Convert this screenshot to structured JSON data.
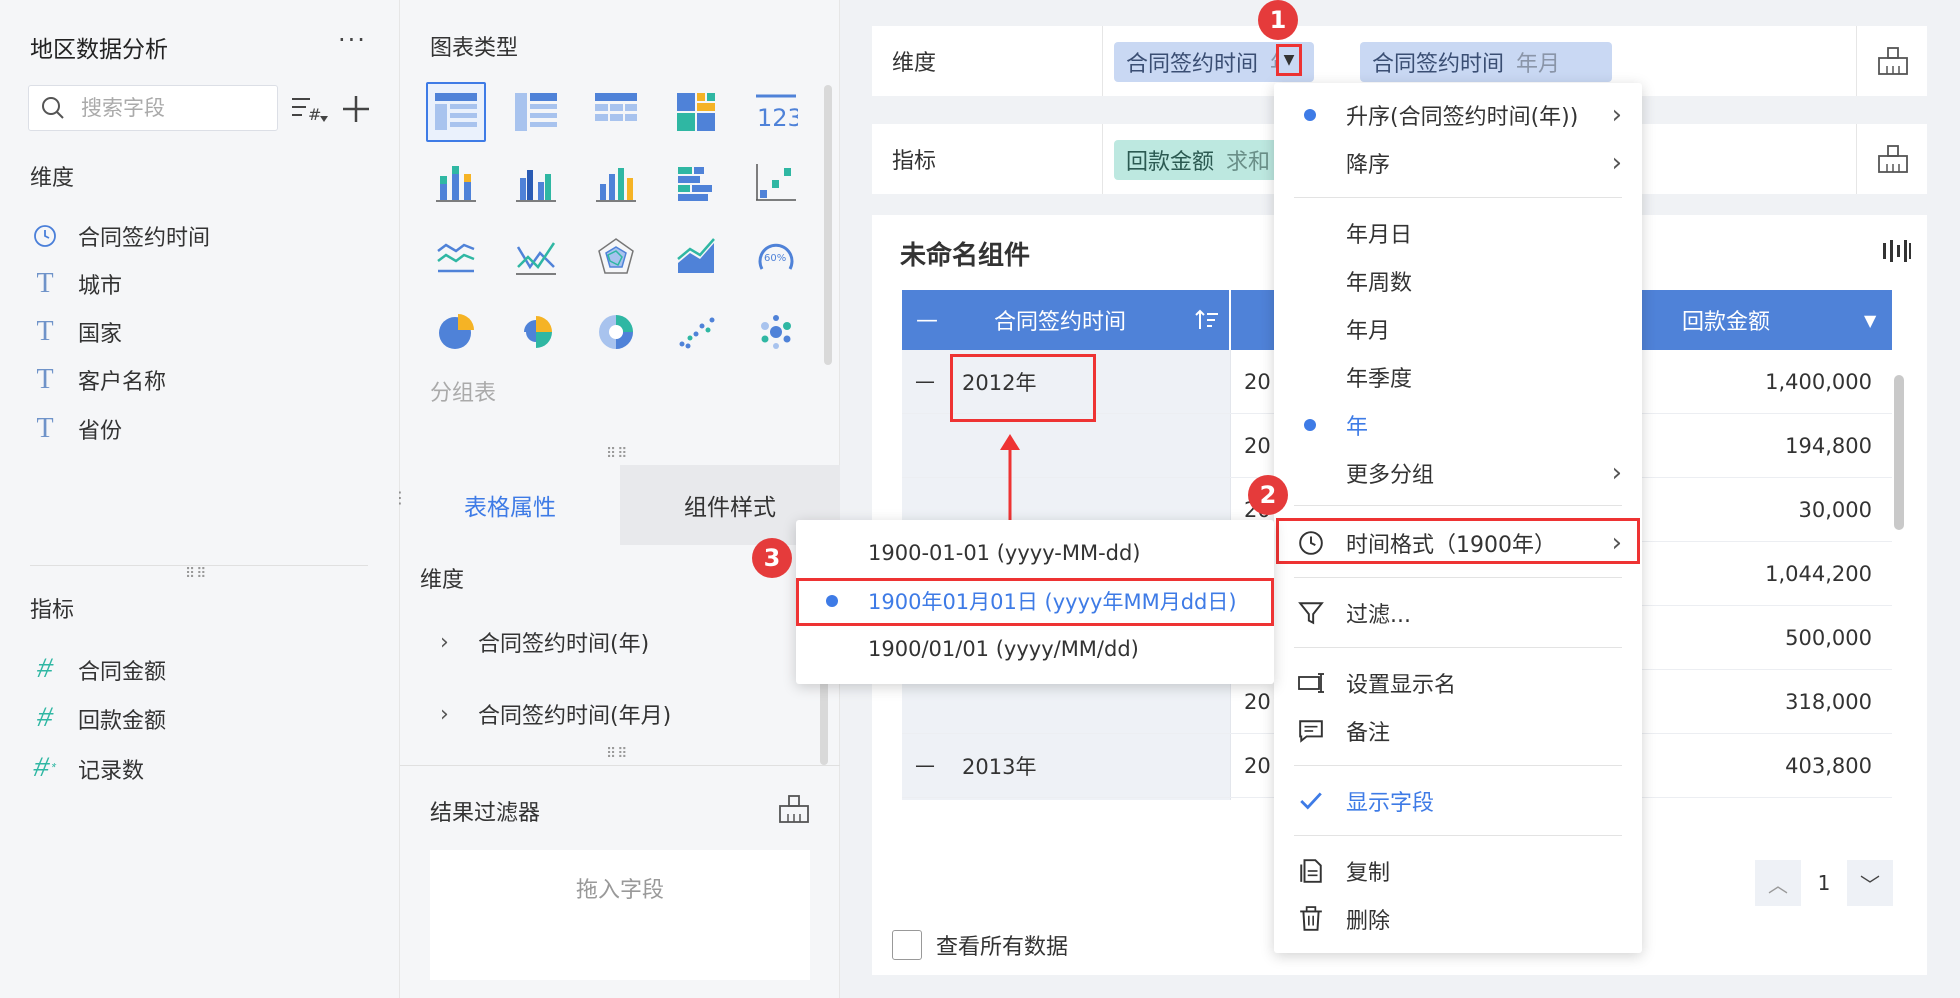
{
  "left": {
    "title": "地区数据分析",
    "more": "···",
    "search_placeholder": "搜索字段",
    "dim_label": "维度",
    "dimensions": [
      {
        "icon": "clock-icon",
        "label": "合同签约时间"
      },
      {
        "icon": "text-type-icon",
        "label": "城市"
      },
      {
        "icon": "text-type-icon",
        "label": "国家"
      },
      {
        "icon": "text-type-icon",
        "label": "客户名称"
      },
      {
        "icon": "text-type-icon",
        "label": "省份"
      }
    ],
    "metric_label": "指标",
    "metrics": [
      {
        "icon": "number-type-icon",
        "label": "合同金额"
      },
      {
        "icon": "number-type-icon",
        "label": "回款金额"
      },
      {
        "icon": "record-count-icon",
        "label": "记录数"
      }
    ]
  },
  "mid": {
    "title": "图表类型",
    "caption": "分组表",
    "tabs": [
      "表格属性",
      "组件样式"
    ],
    "dim_label": "维度",
    "dim_items": [
      "合同签约时间(年)",
      "合同签约时间(年月)"
    ],
    "filter_title": "结果过滤器",
    "drop_text": "拖入字段"
  },
  "right": {
    "dim_row_label": "维度",
    "dim_pills": [
      {
        "name": "合同签约时间",
        "sub": "年"
      },
      {
        "name": "合同签约时间",
        "sub": "年月"
      }
    ],
    "metric_row_label": "指标",
    "metric_pill": {
      "name": "回款金额",
      "sub": "求和"
    },
    "widget_title": "未命名组件",
    "header": {
      "col1": "合同签约时间",
      "col3": "回款金额"
    },
    "rows": [
      {
        "group": "2012年",
        "sub": "20",
        "value": "1,400,000"
      },
      {
        "group": "",
        "sub": "20",
        "value": "194,800"
      },
      {
        "group": "",
        "sub": "20",
        "value": "30,000"
      },
      {
        "group": "",
        "sub": "",
        "value": "1,044,200"
      },
      {
        "group": "",
        "sub": "",
        "value": "500,000"
      },
      {
        "group": "",
        "sub": "20",
        "value": "318,000"
      },
      {
        "group": "2013年",
        "sub": "20",
        "value": "403,800"
      }
    ],
    "page_number": "1",
    "view_all": "查看所有数据"
  },
  "menu": {
    "items": [
      {
        "label": "升序(合同签约时间(年))",
        "dot": true,
        "chevron": true
      },
      {
        "label": "降序",
        "chevron": true
      },
      {
        "label": "年月日"
      },
      {
        "label": "年周数"
      },
      {
        "label": "年月"
      },
      {
        "label": "年季度"
      },
      {
        "label": "年",
        "dot": true,
        "blue": true
      },
      {
        "label": "更多分组",
        "chevron": true
      },
      {
        "label": "时间格式（1900年）",
        "chevron": true,
        "icon": "clock-icon"
      },
      {
        "label": "过滤...",
        "icon": "filter-icon"
      },
      {
        "label": "设置显示名",
        "icon": "rename-icon"
      },
      {
        "label": "备注",
        "icon": "comment-icon"
      },
      {
        "label": "显示字段",
        "icon": "check-icon",
        "blue": true
      },
      {
        "label": "复制",
        "icon": "copy-icon"
      },
      {
        "label": "删除",
        "icon": "trash-icon"
      }
    ]
  },
  "submenu": {
    "items": [
      {
        "label": "1900-01-01 (yyyy-MM-dd)"
      },
      {
        "label": "1900年01月01日 (yyyy年MM月dd日)",
        "selected": true
      },
      {
        "label": "1900/01/01 (yyyy/MM/dd)"
      }
    ]
  },
  "badges": [
    "1",
    "2",
    "3"
  ],
  "colors": {
    "accent": "#3e7be6",
    "highlight": "#e33333",
    "header": "#4f82d8"
  }
}
